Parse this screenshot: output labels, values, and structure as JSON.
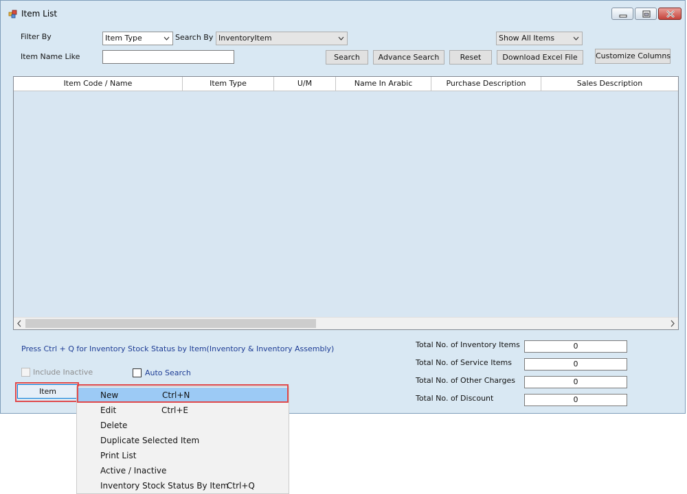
{
  "window": {
    "title": "Item List"
  },
  "filters": {
    "filter_by_label": "Filter By",
    "filter_by_value": "Item Type",
    "search_by_label": "Search By",
    "search_by_value": "InventoryItem",
    "show_value": "Show All Items",
    "item_name_label": "Item Name Like",
    "item_name_value": ""
  },
  "buttons": {
    "search": "Search",
    "advance_search": "Advance Search",
    "reset": "Reset",
    "download": "Download Excel File",
    "customize": "Customize Columns"
  },
  "grid": {
    "columns": [
      "Item Code / Name",
      "Item Type",
      "U/M",
      "Name In Arabic",
      "Purchase Description",
      "Sales Description"
    ],
    "rows": []
  },
  "hint": "Press Ctrl + Q for Inventory Stock Status by Item(Inventory & Inventory Assembly)",
  "options": {
    "include_inactive": "Include Inactive",
    "auto_search": "Auto Search"
  },
  "totals": [
    {
      "label": "Total No. of Inventory Items",
      "value": "0"
    },
    {
      "label": "Total No. of Service Items",
      "value": "0"
    },
    {
      "label": "Total No. of Other Charges",
      "value": "0"
    },
    {
      "label": "Total No. of Discount",
      "value": "0"
    }
  ],
  "item_button": "Item",
  "menu": [
    {
      "label": "New",
      "shortcut": "Ctrl+N",
      "selected": true
    },
    {
      "label": "Edit",
      "shortcut": "Ctrl+E"
    },
    {
      "label": "Delete",
      "shortcut": ""
    },
    {
      "label": "Duplicate Selected Item",
      "shortcut": ""
    },
    {
      "label": "Print List",
      "shortcut": ""
    },
    {
      "label": "Active / Inactive",
      "shortcut": ""
    },
    {
      "label": "Inventory Stock Status By Item",
      "shortcut": "Ctrl+Q"
    }
  ],
  "colors": {
    "highlight": "#e0484a",
    "selected": "#9ccaf5",
    "hint": "#1c3b94"
  },
  "icons": [
    "app-icon",
    "minimize-icon",
    "maximize-icon",
    "close-icon",
    "chevron-down-icon",
    "scroll-left-icon",
    "scroll-right-icon"
  ]
}
